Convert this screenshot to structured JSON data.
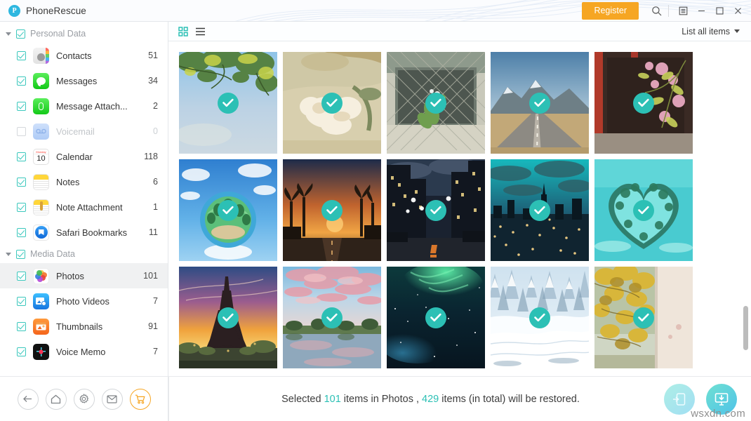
{
  "titlebar": {
    "app_name": "PhoneRescue",
    "logo_glyph": "P",
    "register_label": "Register",
    "icons": {
      "search": "search-icon",
      "menu": "menu-icon",
      "minimize": "minimize-icon",
      "maximize": "maximize-icon",
      "close": "close-icon"
    },
    "accent_orange": "#f6a623"
  },
  "sidebar": {
    "groups": [
      {
        "label": "Personal Data",
        "checked": true,
        "expanded": true,
        "items": [
          {
            "label": "Contacts",
            "count": "51",
            "checked": true,
            "enabled": true,
            "icon": "contacts-icon"
          },
          {
            "label": "Messages",
            "count": "34",
            "checked": true,
            "enabled": true,
            "icon": "messages-icon"
          },
          {
            "label": "Message Attach...",
            "count": "2",
            "checked": true,
            "enabled": true,
            "icon": "message-attachment-icon"
          },
          {
            "label": "Voicemail",
            "count": "0",
            "checked": false,
            "enabled": false,
            "icon": "voicemail-icon"
          },
          {
            "label": "Calendar",
            "count": "118",
            "checked": true,
            "enabled": true,
            "icon": "calendar-icon"
          },
          {
            "label": "Notes",
            "count": "6",
            "checked": true,
            "enabled": true,
            "icon": "notes-icon"
          },
          {
            "label": "Note Attachment",
            "count": "1",
            "checked": true,
            "enabled": true,
            "icon": "note-attachment-icon"
          },
          {
            "label": "Safari Bookmarks",
            "count": "11",
            "checked": true,
            "enabled": true,
            "icon": "safari-icon"
          }
        ]
      },
      {
        "label": "Media Data",
        "checked": true,
        "expanded": true,
        "items": [
          {
            "label": "Photos",
            "count": "101",
            "checked": true,
            "enabled": true,
            "icon": "photos-icon",
            "active": true
          },
          {
            "label": "Photo Videos",
            "count": "7",
            "checked": true,
            "enabled": true,
            "icon": "photo-videos-icon"
          },
          {
            "label": "Thumbnails",
            "count": "91",
            "checked": true,
            "enabled": true,
            "icon": "thumbnails-icon"
          },
          {
            "label": "Voice Memo",
            "count": "7",
            "checked": true,
            "enabled": true,
            "icon": "voice-memo-icon"
          }
        ]
      }
    ],
    "bottom_buttons": [
      {
        "name": "back-button",
        "icon": "arrow-left-icon"
      },
      {
        "name": "home-button",
        "icon": "home-icon"
      },
      {
        "name": "settings-button",
        "icon": "gear-icon"
      },
      {
        "name": "mail-button",
        "icon": "mail-icon"
      },
      {
        "name": "cart-button",
        "icon": "cart-icon"
      }
    ]
  },
  "main": {
    "view_grid_icon": "grid-view-icon",
    "view_list_icon": "list-view-icon",
    "active_view": "grid",
    "filter_label": "List all items",
    "grid": {
      "columns": 5,
      "items": [
        {
          "id": 1,
          "alt": "tree-branches-against-sky",
          "selected": true
        },
        {
          "id": 2,
          "alt": "dried-white-flower",
          "selected": true
        },
        {
          "id": 3,
          "alt": "plant-behind-chain-link-fence",
          "selected": true
        },
        {
          "id": 4,
          "alt": "desert-road-and-mountains",
          "selected": true
        },
        {
          "id": 5,
          "alt": "pink-blossoms-red-wall",
          "selected": true
        },
        {
          "id": 6,
          "alt": "tiny-planet-island",
          "selected": true
        },
        {
          "id": 7,
          "alt": "palm-street-at-sunset",
          "selected": true
        },
        {
          "id": 8,
          "alt": "night-city-street",
          "selected": true
        },
        {
          "id": 9,
          "alt": "teal-city-skyline-at-night",
          "selected": true
        },
        {
          "id": 10,
          "alt": "heart-shaped-lagoon",
          "selected": true
        },
        {
          "id": 11,
          "alt": "eiffel-tower-at-sunset",
          "selected": true
        },
        {
          "id": 12,
          "alt": "pink-clouds-over-lake",
          "selected": true
        },
        {
          "id": 13,
          "alt": "green-aurora-borealis",
          "selected": true
        },
        {
          "id": 14,
          "alt": "snowy-winter-forest",
          "selected": true
        },
        {
          "id": 15,
          "alt": "autumn-leaves-by-wall",
          "selected": true
        }
      ]
    }
  },
  "statusbar": {
    "text_prefix": "Selected ",
    "selected_count": "101",
    "text_middle": " items in Photos , ",
    "total_count": "429",
    "text_suffix": " items (in total) will be restored.",
    "buttons": [
      {
        "name": "restore-to-device-button",
        "icon": "restore-to-device-icon"
      },
      {
        "name": "restore-to-computer-button",
        "icon": "restore-to-computer-icon"
      }
    ],
    "watermark": "wsxdn.com",
    "accent_teal": "#2cc0b5"
  }
}
